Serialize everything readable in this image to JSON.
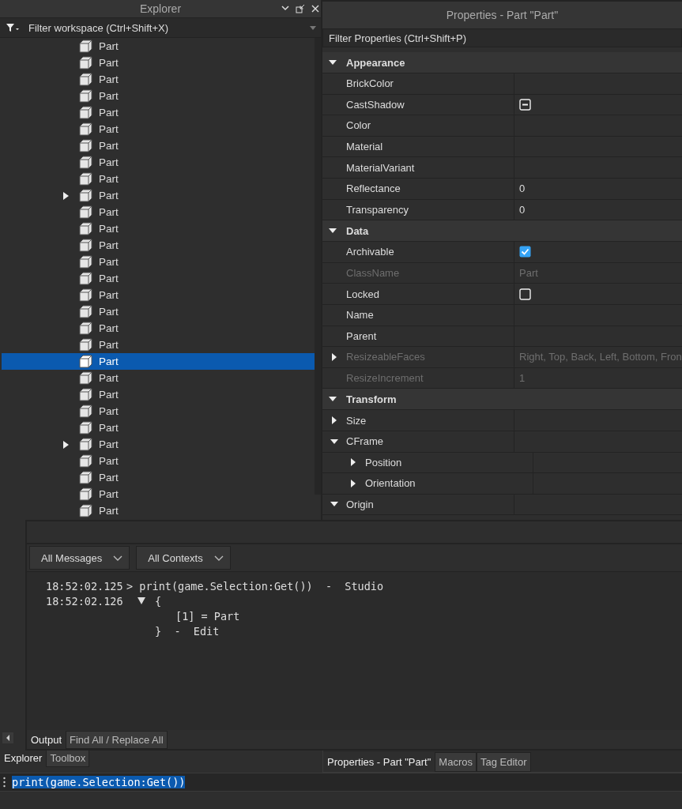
{
  "explorer": {
    "title": "Explorer",
    "filter": {
      "placeholder": "Filter workspace (Ctrl+Shift+X)"
    },
    "items": [
      {
        "label": "Part",
        "selected": false,
        "expandable": false
      },
      {
        "label": "Part",
        "selected": false,
        "expandable": false
      },
      {
        "label": "Part",
        "selected": false,
        "expandable": false
      },
      {
        "label": "Part",
        "selected": false,
        "expandable": false
      },
      {
        "label": "Part",
        "selected": false,
        "expandable": false
      },
      {
        "label": "Part",
        "selected": false,
        "expandable": false
      },
      {
        "label": "Part",
        "selected": false,
        "expandable": false
      },
      {
        "label": "Part",
        "selected": false,
        "expandable": false
      },
      {
        "label": "Part",
        "selected": false,
        "expandable": false
      },
      {
        "label": "Part",
        "selected": false,
        "expandable": true
      },
      {
        "label": "Part",
        "selected": false,
        "expandable": false
      },
      {
        "label": "Part",
        "selected": false,
        "expandable": false
      },
      {
        "label": "Part",
        "selected": false,
        "expandable": false
      },
      {
        "label": "Part",
        "selected": false,
        "expandable": false
      },
      {
        "label": "Part",
        "selected": false,
        "expandable": false
      },
      {
        "label": "Part",
        "selected": false,
        "expandable": false
      },
      {
        "label": "Part",
        "selected": false,
        "expandable": false
      },
      {
        "label": "Part",
        "selected": false,
        "expandable": false
      },
      {
        "label": "Part",
        "selected": false,
        "expandable": false
      },
      {
        "label": "Part",
        "selected": true,
        "expandable": false
      },
      {
        "label": "Part",
        "selected": false,
        "expandable": false
      },
      {
        "label": "Part",
        "selected": false,
        "expandable": false
      },
      {
        "label": "Part",
        "selected": false,
        "expandable": false
      },
      {
        "label": "Part",
        "selected": false,
        "expandable": false
      },
      {
        "label": "Part",
        "selected": false,
        "expandable": true
      },
      {
        "label": "Part",
        "selected": false,
        "expandable": false
      },
      {
        "label": "Part",
        "selected": false,
        "expandable": false
      },
      {
        "label": "Part",
        "selected": false,
        "expandable": false
      },
      {
        "label": "Part",
        "selected": false,
        "expandable": false
      }
    ]
  },
  "properties": {
    "title": "Properties - Part \"Part\"",
    "filter": {
      "placeholder": "Filter Properties (Ctrl+Shift+P)"
    },
    "groups": [
      {
        "name": "Appearance",
        "expanded": true,
        "rows": [
          {
            "name": "BrickColor",
            "disabled": false
          },
          {
            "name": "CastShadow",
            "disabled": false,
            "kind": "checkbox",
            "checked": false,
            "indeterminate": true
          },
          {
            "name": "Color",
            "disabled": false
          },
          {
            "name": "Material",
            "disabled": false
          },
          {
            "name": "MaterialVariant",
            "disabled": false
          },
          {
            "name": "Reflectance",
            "disabled": false,
            "value": "0"
          },
          {
            "name": "Transparency",
            "disabled": false,
            "value": "0"
          }
        ]
      },
      {
        "name": "Data",
        "expanded": true,
        "rows": [
          {
            "name": "Archivable",
            "disabled": false,
            "kind": "checkbox",
            "checked": true,
            "indeterminate": false
          },
          {
            "name": "ClassName",
            "disabled": true,
            "value": "Part"
          },
          {
            "name": "Locked",
            "disabled": false,
            "kind": "checkbox",
            "checked": false,
            "indeterminate": false
          },
          {
            "name": "Name",
            "disabled": false
          },
          {
            "name": "Parent",
            "disabled": false
          },
          {
            "name": "ResizeableFaces",
            "disabled": true,
            "expanded": false,
            "value": "Right, Top, Back, Left, Bottom, Fron"
          },
          {
            "name": "ResizeIncrement",
            "disabled": true,
            "value": "1"
          }
        ]
      },
      {
        "name": "Transform",
        "expanded": true,
        "rows": [
          {
            "name": "Size",
            "disabled": false,
            "expanded": false
          },
          {
            "name": "CFrame",
            "disabled": false,
            "expanded": true,
            "children": [
              {
                "name": "Position",
                "disabled": false,
                "expanded": false
              },
              {
                "name": "Orientation",
                "disabled": false,
                "expanded": false
              }
            ]
          },
          {
            "name": "Origin",
            "disabled": false,
            "expanded": true
          }
        ]
      }
    ]
  },
  "output": {
    "filters": [
      {
        "label": "All Messages"
      },
      {
        "label": "All Contexts"
      }
    ],
    "lines": [
      {
        "kind": "command",
        "time": "18:52:02.125",
        "text": "> print(game.Selection:Get())  -  Studio"
      },
      {
        "kind": "table-open",
        "time": "18:52:02.126",
        "text": "{",
        "expanded": true
      },
      {
        "kind": "entry",
        "text": "[1] = Part"
      },
      {
        "kind": "table-close",
        "text": "}  -  Edit"
      }
    ],
    "tabs": [
      {
        "label": "Output",
        "selected": true
      },
      {
        "label": "Find All / Replace All",
        "selected": false
      }
    ]
  },
  "explorer_tabs": [
    {
      "label": "Explorer",
      "selected": true
    },
    {
      "label": "Toolbox",
      "selected": false
    }
  ],
  "properties_tabs": [
    {
      "label": "Properties - Part \"Part\"",
      "selected": true
    },
    {
      "label": "Macros",
      "selected": false
    },
    {
      "label": "Tag Editor",
      "selected": false
    }
  ],
  "command_bar": {
    "value": "print(game.Selection:Get())",
    "highlighted": true
  }
}
